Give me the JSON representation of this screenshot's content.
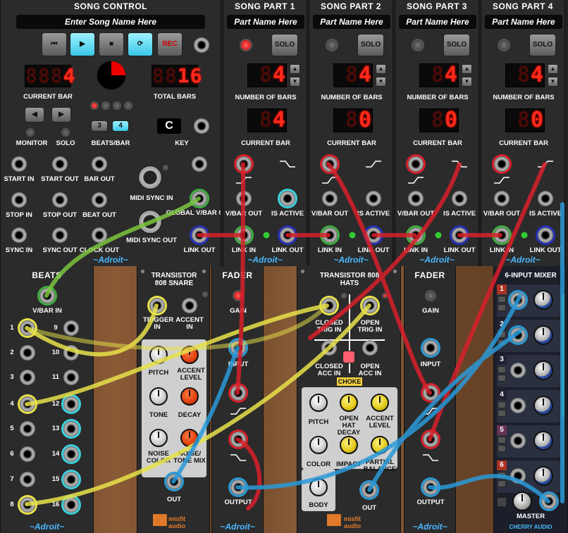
{
  "song_control": {
    "title": "SONG CONTROL",
    "song_name_placeholder": "Enter Song Name Here",
    "rec_label": "REC",
    "current_bar_digits": "4",
    "current_bar_label": "CURRENT BAR",
    "total_bars_digits": "16",
    "total_bars_label": "TOTAL BARS",
    "monitor_label": "MONITOR",
    "solo_label": "SOLO",
    "beats_per_bar_label": "BEATS/BAR",
    "beats_opt_3": "3",
    "beats_opt_4": "4",
    "key_value": "C",
    "key_label": "KEY",
    "jacks": [
      "START IN",
      "START OUT",
      "BAR OUT",
      "STOP IN",
      "STOP OUT",
      "BEAT OUT",
      "SYNC IN",
      "SYNC OUT",
      "CLOCK OUT"
    ],
    "midi_sync_in": "MIDI SYNC IN",
    "midi_sync_out": "MIDI SYNC OUT",
    "global_vbar_out": "GLOBAL V/BAR OUT",
    "link_out": "LINK OUT",
    "brand": "~Adroit~",
    "progress_fraction": 0.25
  },
  "parts": [
    {
      "title": "SONG PART 1",
      "name_placeholder": "Part Name Here",
      "solo": "SOLO",
      "num_bars": "4",
      "num_bars_label": "NUMBER OF BARS",
      "current_bar": "4",
      "current_bar_label": "CURRENT BAR",
      "vbar_out": "V/BAR OUT",
      "is_active": "IS ACTIVE",
      "link_in": "LINK IN",
      "link_out": "LINK OUT",
      "brand": "~Adroit~",
      "active": true
    },
    {
      "title": "SONG PART 2",
      "name_placeholder": "Part Name Here",
      "solo": "SOLO",
      "num_bars": "4",
      "num_bars_label": "NUMBER OF BARS",
      "current_bar": "0",
      "current_bar_label": "CURRENT BAR",
      "vbar_out": "V/BAR OUT",
      "is_active": "IS ACTIVE",
      "link_in": "LINK IN",
      "link_out": "LINK OUT",
      "brand": "~Adroit~",
      "active": false
    },
    {
      "title": "SONG PART 3",
      "name_placeholder": "Part Name Here",
      "solo": "SOLO",
      "num_bars": "4",
      "num_bars_label": "NUMBER OF BARS",
      "current_bar": "0",
      "current_bar_label": "CURRENT BAR",
      "vbar_out": "V/BAR OUT",
      "is_active": "IS ACTIVE",
      "link_in": "LINK IN",
      "link_out": "LINK OUT",
      "brand": "~Adroit~",
      "active": false
    },
    {
      "title": "SONG PART 4",
      "name_placeholder": "Part Name Here",
      "solo": "SOLO",
      "num_bars": "4",
      "num_bars_label": "NUMBER OF BARS",
      "current_bar": "0",
      "current_bar_label": "CURRENT BAR",
      "vbar_out": "V/BAR OUT",
      "is_active": "IS ACTIVE",
      "link_in": "LINK IN",
      "link_out": "LINK OUT",
      "brand": "~Adroit~",
      "active": false
    }
  ],
  "beats": {
    "title": "BEATS",
    "vbar_in": "V/BAR IN",
    "numbers_left": [
      "1",
      "2",
      "3",
      "4",
      "5",
      "6",
      "7",
      "8"
    ],
    "numbers_right": [
      "9",
      "10",
      "11",
      "12",
      "13",
      "14",
      "15",
      "16"
    ],
    "brand": "~Adroit~"
  },
  "snare": {
    "title": "TRANSISTOR 808 SNARE",
    "trigger_in": "TRIGGER IN",
    "accent_in": "ACCENT IN",
    "pitch": "PITCH",
    "accent_level": "ACCENT LEVEL",
    "tone": "TONE",
    "decay": "DECAY",
    "noise_color": "NOISE COLOR",
    "noise_tone_mix": "NOISE/ TONE MIX",
    "out": "OUT",
    "brand_top": "misfit",
    "brand_bottom": "audio"
  },
  "fader1": {
    "title": "FADER",
    "gain": "GAIN",
    "input": "INPUT",
    "output": "OUTPUT",
    "brand": "~Adroit~"
  },
  "hats": {
    "title": "TRANSISTOR 808 HATS",
    "closed_trig_in": "CLOSED TRIG IN",
    "open_trig_in": "OPEN TRIG IN",
    "closed_acc_in": "CLOSED ACC IN",
    "open_acc_in": "OPEN ACC IN",
    "choke": "CHOKE",
    "pitch": "PITCH",
    "open_hat_decay": "OPEN HAT DECAY",
    "accent_level": "ACCENT LEVEL",
    "color": "COLOR",
    "impact": "IMPACT",
    "partial_balance": "PARTIAL BALANCE",
    "body": "BODY",
    "out": "OUT",
    "brand_top": "misfit",
    "brand_bottom": "audio"
  },
  "fader2": {
    "title": "FADER",
    "gain": "GAIN",
    "input": "INPUT",
    "output": "OUTPUT",
    "brand": "~Adroit~"
  },
  "mixer": {
    "title": "6-INPUT MIXER",
    "channels": [
      "1",
      "2",
      "3",
      "4",
      "5",
      "6"
    ],
    "master": "MASTER",
    "brand": "CHERRY AUDIO"
  },
  "colors": {
    "cable_yellow": "#e8e24a",
    "cable_red": "#d8202a",
    "cable_green": "#7cc640",
    "cable_blue": "#2a9ad8",
    "accent_cyan": "#3cd3e0"
  }
}
